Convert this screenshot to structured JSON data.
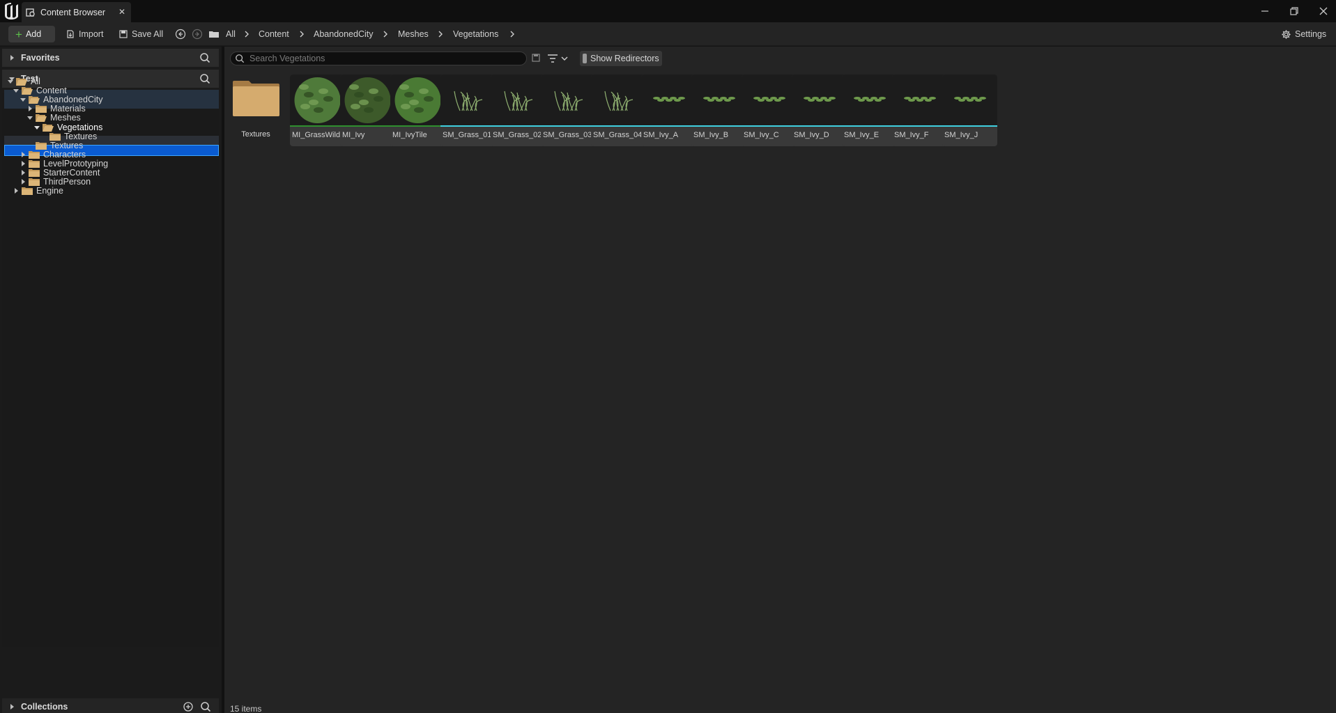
{
  "window": {
    "tab_title": "Content Browser",
    "close_glyph": "✕",
    "controls": [
      "minimize-icon",
      "restore-icon",
      "close-icon"
    ]
  },
  "toolbar": {
    "add_label": "Add",
    "import_label": "Import",
    "save_all_label": "Save All",
    "settings_label": "Settings"
  },
  "breadcrumb": [
    "All",
    "Content",
    "AbandonedCity",
    "Meshes",
    "Vegetations"
  ],
  "left": {
    "favorites_label": "Favorites",
    "test_label": "Test",
    "collections_label": "Collections",
    "tree": [
      {
        "label": "All",
        "expanded": true
      },
      {
        "label": "Content",
        "expanded": true
      },
      {
        "label": "AbandonedCity",
        "expanded": true
      },
      {
        "label": "Materials",
        "expanded": false
      },
      {
        "label": "Meshes",
        "expanded": true
      },
      {
        "label": "Vegetations",
        "expanded": true,
        "selected": true
      },
      {
        "label": "Textures"
      },
      {
        "label": "Textures"
      },
      {
        "label": "Characters",
        "expanded": false
      },
      {
        "label": "LevelPrototyping",
        "expanded": false
      },
      {
        "label": "StarterContent",
        "expanded": false
      },
      {
        "label": "ThirdPerson",
        "expanded": false
      },
      {
        "label": "Engine",
        "expanded": false
      }
    ]
  },
  "content": {
    "search_placeholder": "Search Vegetations",
    "show_redirectors_label": "Show Redirectors",
    "folder_label": "Textures",
    "assets": [
      {
        "name": "MI_GrassWild",
        "kind": "material"
      },
      {
        "name": "MI_Ivy",
        "kind": "material"
      },
      {
        "name": "MI_IvyTile",
        "kind": "material"
      },
      {
        "name": "SM_Grass_01",
        "kind": "mesh"
      },
      {
        "name": "SM_Grass_02",
        "kind": "mesh"
      },
      {
        "name": "SM_Grass_03",
        "kind": "mesh"
      },
      {
        "name": "SM_Grass_04",
        "kind": "mesh"
      },
      {
        "name": "SM_Ivy_A",
        "kind": "mesh"
      },
      {
        "name": "SM_Ivy_B",
        "kind": "mesh"
      },
      {
        "name": "SM_Ivy_C",
        "kind": "mesh"
      },
      {
        "name": "SM_Ivy_D",
        "kind": "mesh"
      },
      {
        "name": "SM_Ivy_E",
        "kind": "mesh"
      },
      {
        "name": "SM_Ivy_F",
        "kind": "mesh"
      },
      {
        "name": "SM_Ivy_J",
        "kind": "mesh"
      }
    ],
    "status": "15 items"
  },
  "colors": {
    "material_bar": "#2f8f2f",
    "mesh_bar": "#3fd0e0",
    "selection": "#0a5bd1",
    "add_plus": "#5cc04a"
  }
}
